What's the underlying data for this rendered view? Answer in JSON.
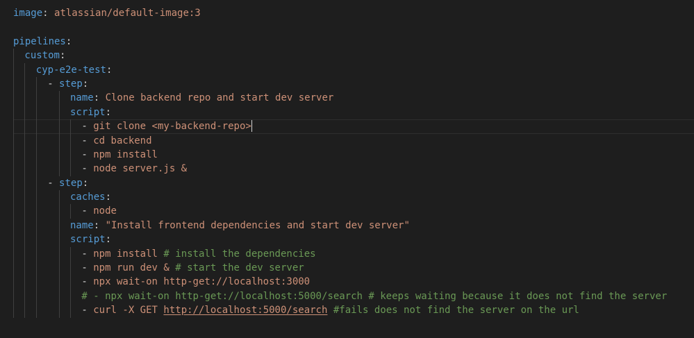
{
  "editor": {
    "lines": [
      {
        "indent": 0,
        "guides": [],
        "tokens": [
          [
            "key",
            "image"
          ],
          [
            "punc",
            ": "
          ],
          [
            "str",
            "atlassian/default-image:3"
          ]
        ]
      },
      {
        "indent": 0,
        "guides": [],
        "tokens": []
      },
      {
        "indent": 0,
        "guides": [],
        "tokens": [
          [
            "key",
            "pipelines"
          ],
          [
            "punc",
            ":"
          ]
        ]
      },
      {
        "indent": 1,
        "guides": [
          0
        ],
        "tokens": [
          [
            "key",
            "custom"
          ],
          [
            "punc",
            ":"
          ]
        ]
      },
      {
        "indent": 2,
        "guides": [
          0,
          1
        ],
        "tokens": [
          [
            "key",
            "cyp-e2e-test"
          ],
          [
            "punc",
            ":"
          ]
        ]
      },
      {
        "indent": 3,
        "guides": [
          0,
          1,
          2
        ],
        "tokens": [
          [
            "dash",
            "- "
          ],
          [
            "key",
            "step"
          ],
          [
            "punc",
            ":"
          ]
        ]
      },
      {
        "indent": 5,
        "guides": [
          0,
          1,
          2,
          4
        ],
        "tokens": [
          [
            "key",
            "name"
          ],
          [
            "punc",
            ": "
          ],
          [
            "str",
            "Clone backend repo and start dev server"
          ]
        ]
      },
      {
        "indent": 5,
        "guides": [
          0,
          1,
          2,
          4
        ],
        "tokens": [
          [
            "key",
            "script"
          ],
          [
            "punc",
            ":"
          ]
        ]
      },
      {
        "indent": 6,
        "guides": [
          0,
          1,
          2,
          4,
          5
        ],
        "active": true,
        "cursor": true,
        "tokens": [
          [
            "dash",
            "- "
          ],
          [
            "str",
            "git clone <my-backend-repo>"
          ]
        ]
      },
      {
        "indent": 6,
        "guides": [
          0,
          1,
          2,
          4,
          5
        ],
        "tokens": [
          [
            "dash",
            "- "
          ],
          [
            "str",
            "cd backend"
          ]
        ]
      },
      {
        "indent": 6,
        "guides": [
          0,
          1,
          2,
          4,
          5
        ],
        "tokens": [
          [
            "dash",
            "- "
          ],
          [
            "str",
            "npm install"
          ]
        ]
      },
      {
        "indent": 6,
        "guides": [
          0,
          1,
          2,
          4,
          5
        ],
        "tokens": [
          [
            "dash",
            "- "
          ],
          [
            "str",
            "node server.js &"
          ]
        ]
      },
      {
        "indent": 3,
        "guides": [
          0,
          1,
          2
        ],
        "tokens": [
          [
            "dash",
            "- "
          ],
          [
            "key",
            "step"
          ],
          [
            "punc",
            ":"
          ]
        ]
      },
      {
        "indent": 5,
        "guides": [
          0,
          1,
          2,
          4
        ],
        "tokens": [
          [
            "key",
            "caches"
          ],
          [
            "punc",
            ":"
          ]
        ]
      },
      {
        "indent": 6,
        "guides": [
          0,
          1,
          2,
          4,
          5
        ],
        "tokens": [
          [
            "dash",
            "- "
          ],
          [
            "str",
            "node"
          ]
        ]
      },
      {
        "indent": 5,
        "guides": [
          0,
          1,
          2,
          4
        ],
        "tokens": [
          [
            "key",
            "name"
          ],
          [
            "punc",
            ": "
          ],
          [
            "str",
            "\"Install frontend dependencies and start dev server\""
          ]
        ]
      },
      {
        "indent": 5,
        "guides": [
          0,
          1,
          2,
          4
        ],
        "tokens": [
          [
            "key",
            "script"
          ],
          [
            "punc",
            ":"
          ]
        ]
      },
      {
        "indent": 6,
        "guides": [
          0,
          1,
          2,
          4,
          5
        ],
        "tokens": [
          [
            "dash",
            "- "
          ],
          [
            "str",
            "npm install "
          ],
          [
            "cmt",
            "# install the dependencies"
          ]
        ]
      },
      {
        "indent": 6,
        "guides": [
          0,
          1,
          2,
          4,
          5
        ],
        "tokens": [
          [
            "dash",
            "- "
          ],
          [
            "str",
            "npm run dev & "
          ],
          [
            "cmt",
            "# start the dev server"
          ]
        ]
      },
      {
        "indent": 6,
        "guides": [
          0,
          1,
          2,
          4,
          5
        ],
        "tokens": [
          [
            "dash",
            "- "
          ],
          [
            "str",
            "npx wait-on http-get://localhost:3000"
          ]
        ]
      },
      {
        "indent": 6,
        "guides": [
          0,
          1,
          2,
          4,
          5
        ],
        "tokens": [
          [
            "cmt",
            "# - npx wait-on http-get://localhost:5000/search # keeps waiting because it does not find the server"
          ]
        ]
      },
      {
        "indent": 6,
        "guides": [
          0,
          1,
          2,
          4,
          5
        ],
        "tokens": [
          [
            "dash",
            "- "
          ],
          [
            "str",
            "curl -X GET "
          ],
          [
            "link",
            "http://localhost:5000/search"
          ],
          [
            "cmt",
            " #fails does not find the server on the url"
          ]
        ]
      }
    ]
  }
}
